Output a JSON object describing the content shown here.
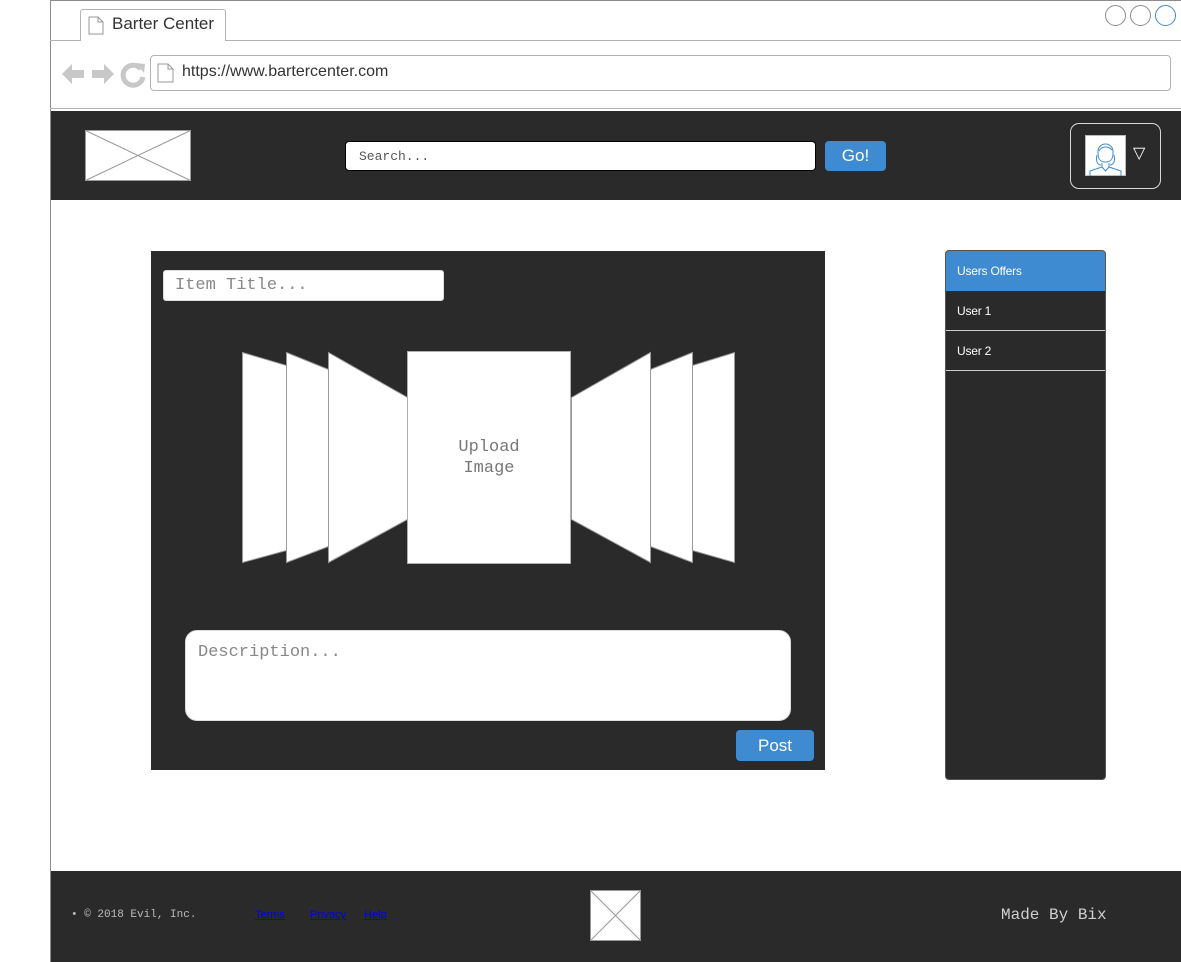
{
  "browser": {
    "tab_title": "Barter Center",
    "url": "https://www.bartercenter.com",
    "window_buttons": [
      "minimize",
      "maximize",
      "close"
    ],
    "nav_icons": [
      "back-arrow-icon",
      "forward-arrow-icon",
      "reload-icon"
    ]
  },
  "header": {
    "logo": "image-placeholder",
    "search": {
      "placeholder": "Search..."
    },
    "go_label": "Go!",
    "profile": {
      "avatar": "user-avatar",
      "dropdown_glyph": "▽"
    }
  },
  "post_form": {
    "item_title_placeholder": "Item Title...",
    "upload_image_label": "Upload Image",
    "description_placeholder": "Description...",
    "post_label": "Post"
  },
  "sidebar": {
    "items": [
      {
        "label": "Users Offers",
        "active": true
      },
      {
        "label": "User 1",
        "active": false
      },
      {
        "label": "User 2",
        "active": false
      }
    ]
  },
  "footer": {
    "copyright": "• © 2018 Evil, Inc.",
    "links": [
      "Terms",
      "Privacy",
      "Help"
    ],
    "made_by": "Made By Bix"
  },
  "colors": {
    "accent": "#3e8bd2",
    "dark": "#2a2a2a"
  }
}
